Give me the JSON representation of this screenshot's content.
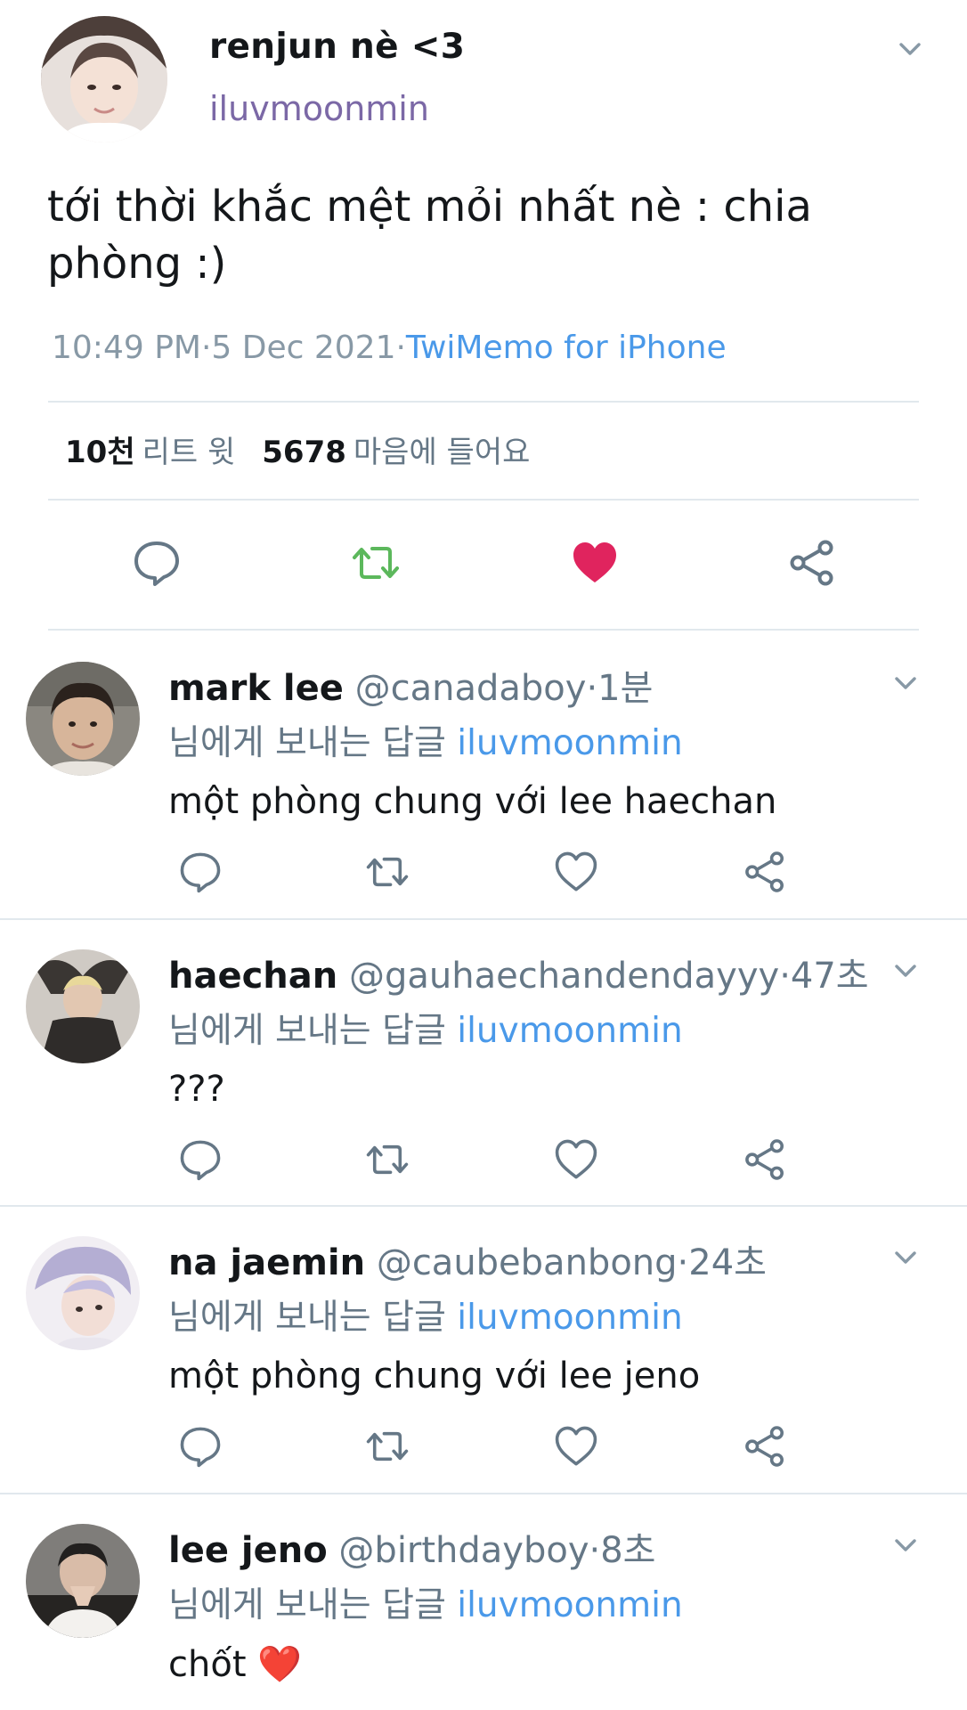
{
  "tweet": {
    "name": "renjun nè <3",
    "handle": "iluvmoonmin",
    "text": "tới thời khắc mệt mỏi nhất nè : chia phòng :)",
    "time": "10:49 PM·5 Dec 2021·",
    "source": "TwiMemo for iPhone",
    "retweets_count": "10천",
    "retweets_label": "리트 윗",
    "likes_count": "5678",
    "likes_label": "마음에 들어요",
    "liked": true
  },
  "colors": {
    "retweet_green": "#5cb85c",
    "like_red": "#e0245e",
    "link_blue": "#4a99e9",
    "handle_purple": "#7b68a6",
    "gray": "#657786"
  },
  "replies": [
    {
      "name": "mark lee",
      "handle": "@canadaboy",
      "time": "·1분",
      "to_label": "님에게 보내는 답글",
      "to_user": "iluvmoonmin",
      "text": "một phòng chung với lee haechan"
    },
    {
      "name": "haechan",
      "handle": "@gauhaechandendayyy",
      "time": "·47초",
      "to_label": "님에게 보내는 답글",
      "to_user": "iluvmoonmin",
      "text": "???"
    },
    {
      "name": "na jaemin",
      "handle": "@caubebanbong",
      "time": "·24초",
      "to_label": "님에게 보내는 답글",
      "to_user": "iluvmoonmin",
      "text": "một phòng chung với lee jeno"
    },
    {
      "name": "lee jeno",
      "handle": "@birthdayboy",
      "time": "·8초",
      "to_label": "님에게 보내는 답글",
      "to_user": "iluvmoonmin",
      "text": "chốt ❤️"
    }
  ],
  "icons": {
    "reply": "speech-bubble-icon",
    "retweet": "retweet-arrows-icon",
    "like": "heart-icon",
    "share": "share-nodes-icon",
    "more": "chevron-down-icon"
  }
}
